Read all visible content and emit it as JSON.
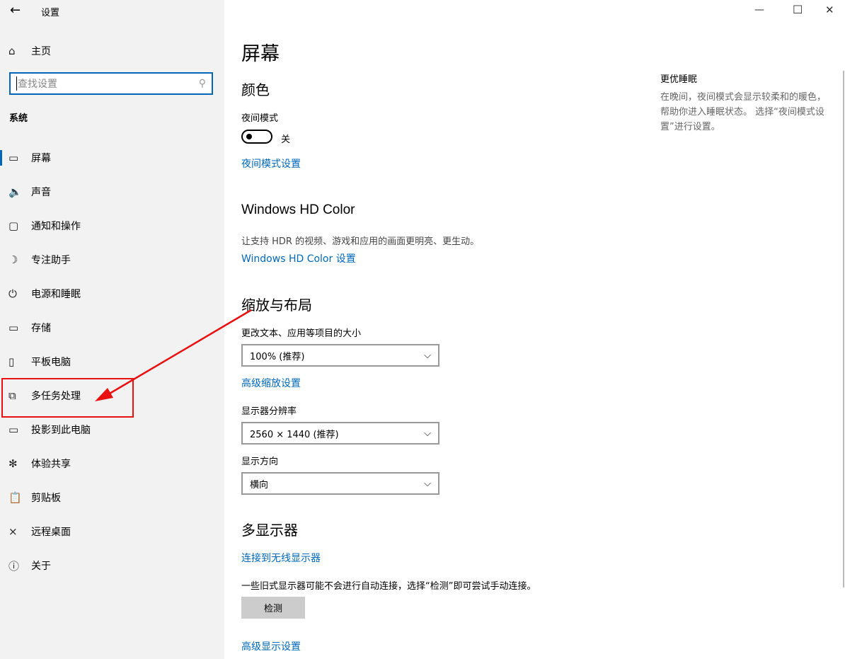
{
  "window": {
    "title": "设置",
    "back": "←",
    "minimize": "—",
    "maximize": "☐",
    "close": "✕"
  },
  "sidebar": {
    "home": "主页",
    "search_placeholder": "查找设置",
    "section": "系统",
    "items": [
      {
        "icon": "monitor-icon",
        "glyph": "▭",
        "label": "屏幕"
      },
      {
        "icon": "speaker-icon",
        "glyph": "🔈",
        "label": "声音"
      },
      {
        "icon": "notification-icon",
        "glyph": "▢",
        "label": "通知和操作"
      },
      {
        "icon": "moon-icon",
        "glyph": "☽",
        "label": "专注助手"
      },
      {
        "icon": "power-icon",
        "glyph": "⏻",
        "label": "电源和睡眠"
      },
      {
        "icon": "storage-icon",
        "glyph": "▭",
        "label": "存储"
      },
      {
        "icon": "tablet-icon",
        "glyph": "▯",
        "label": "平板电脑"
      },
      {
        "icon": "multitask-icon",
        "glyph": "⧉",
        "label": "多任务处理"
      },
      {
        "icon": "project-icon",
        "glyph": "▭",
        "label": "投影到此电脑"
      },
      {
        "icon": "share-icon",
        "glyph": "✻",
        "label": "体验共享"
      },
      {
        "icon": "clipboard-icon",
        "glyph": "📋",
        "label": "剪贴板"
      },
      {
        "icon": "remote-icon",
        "glyph": "⨯",
        "label": "远程桌面"
      },
      {
        "icon": "info-icon",
        "glyph": "ⓘ",
        "label": "关于"
      }
    ]
  },
  "main": {
    "title": "屏幕",
    "color": "颜色",
    "night_label": "夜间模式",
    "night_state": "关",
    "night_link": "夜间模式设置",
    "hd_title": "Windows HD Color",
    "hd_desc": "让支持 HDR 的视频、游戏和应用的画面更明亮、更生动。",
    "hd_link": "Windows HD Color 设置",
    "scale_title": "缩放与布局",
    "scale_label": "更改文本、应用等项目的大小",
    "scale_value": "100% (推荐)",
    "scale_link": "高级缩放设置",
    "res_label": "显示器分辨率",
    "res_value": "2560 × 1440 (推荐)",
    "orient_label": "显示方向",
    "orient_value": "横向",
    "multi_title": "多显示器",
    "wireless_link": "连接到无线显示器",
    "detect_desc": "一些旧式显示器可能不会进行自动连接，选择“检测”即可尝试手动连接。",
    "detect_button": "检测",
    "advanced_link": "高级显示设置"
  },
  "aside": {
    "title": "更优睡眠",
    "desc": "在晚间，夜间模式会显示较柔和的暖色，帮助你进入睡眠状态。 选择“夜间模式设置”进行设置。"
  },
  "annotation_color": "#e81010"
}
